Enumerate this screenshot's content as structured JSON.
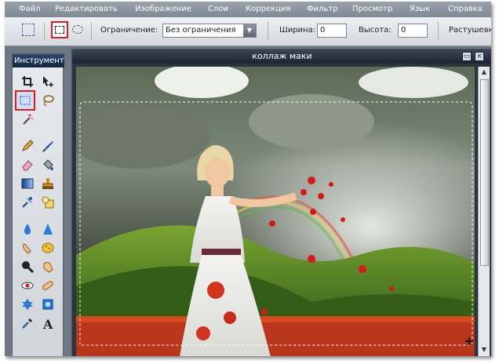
{
  "menu": {
    "items": [
      "Файл",
      "Редактировать",
      "Изображение",
      "Слои",
      "Коррекция",
      "Фильтр",
      "Просмотр",
      "Язык",
      "Справка"
    ]
  },
  "options": {
    "constraint_label": "Ограничение:",
    "constraint_value": "Без ограничения",
    "width_label": "Ширина:",
    "width_value": "0",
    "height_label": "Высота:",
    "height_value": "0",
    "feather_label": "Растушевка"
  },
  "toolbox": {
    "title": "Инструменты",
    "tools": [
      "crop-icon",
      "move-icon",
      "marquee-icon",
      "lasso-icon",
      "magic-wand-icon",
      "pencil-icon",
      "brush-icon",
      "eraser-icon",
      "paint-bucket-icon",
      "gradient-icon",
      "stamp-icon",
      "color-replace-icon",
      "shape-icon",
      "blur-icon",
      "sharpen-icon",
      "smudge-icon",
      "sponge-icon",
      "zoom-icon",
      "dodge-icon",
      "red-eye-icon",
      "bandage-icon",
      "bloat-icon",
      "pinch-icon",
      "eyedropper-icon",
      "text-icon"
    ]
  },
  "document": {
    "title": "коллаж маки"
  },
  "colors": {
    "highlight": "#e11b22",
    "chrome_dark": "#1c2430",
    "ui_gray": "#6e7884"
  }
}
